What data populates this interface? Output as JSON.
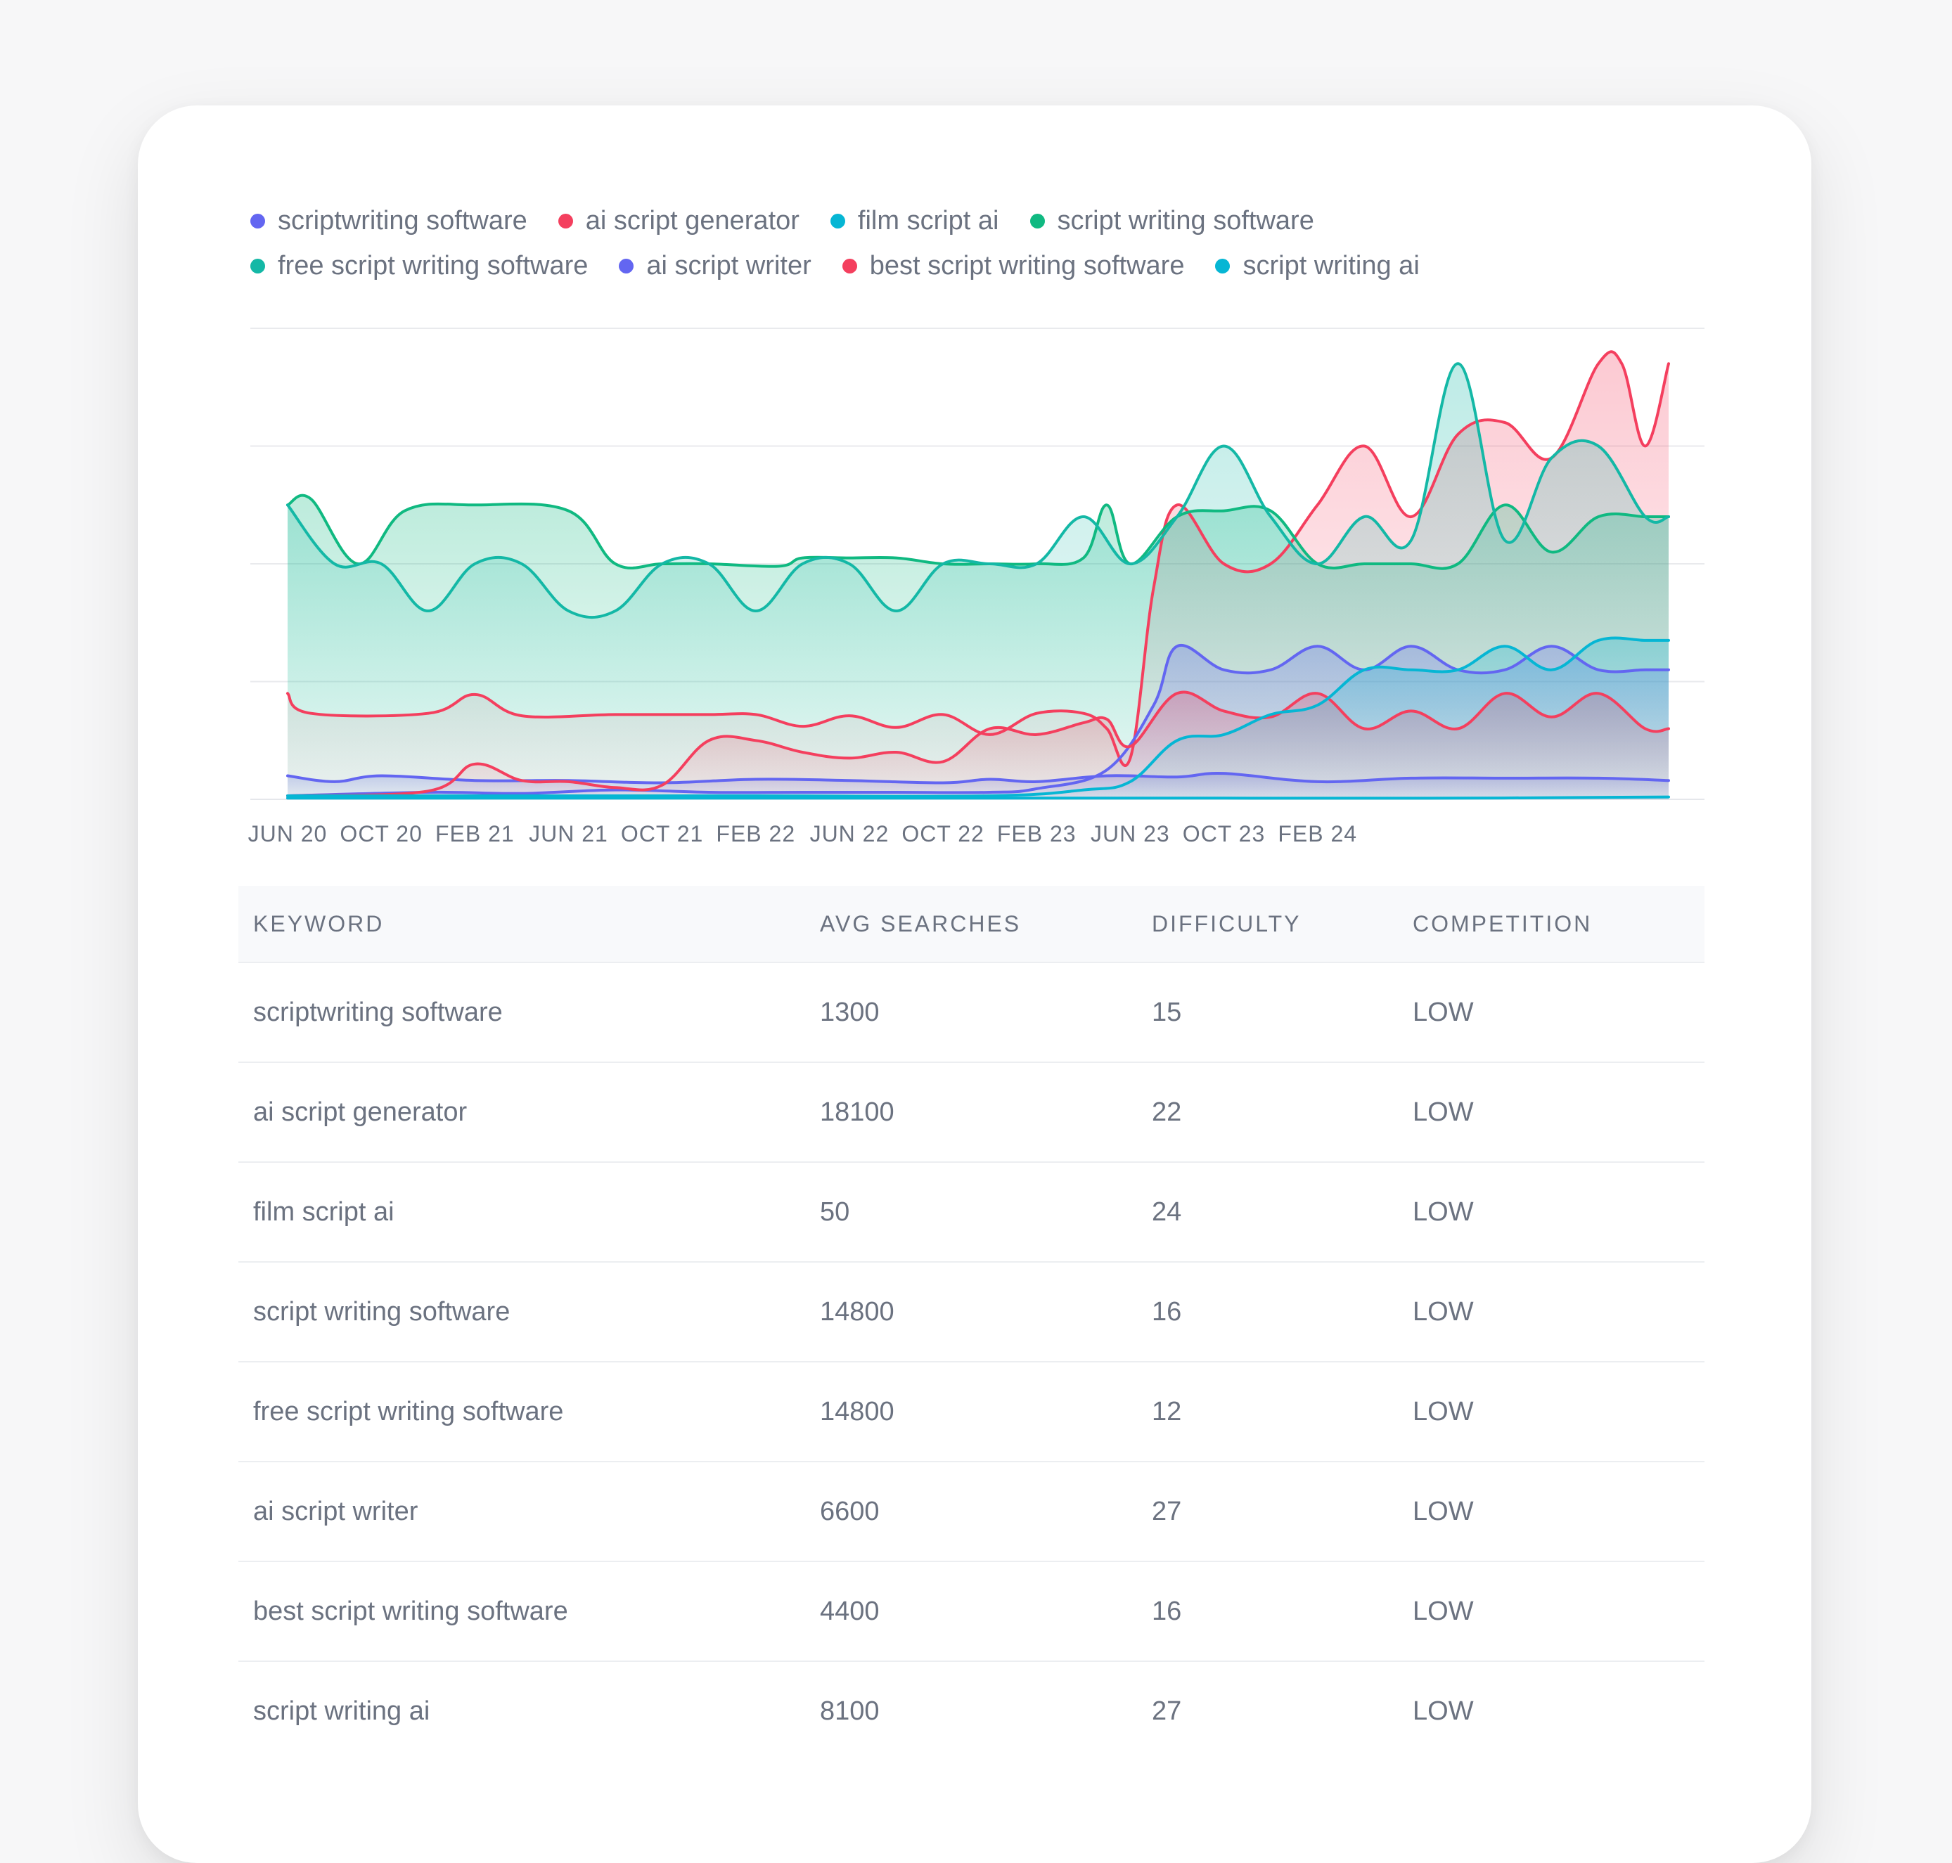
{
  "chart_data": {
    "type": "area",
    "x": [
      "JUN 20",
      "OCT 20",
      "FEB 21",
      "JUN 21",
      "OCT 21",
      "FEB 22",
      "JUN 22",
      "OCT 22",
      "FEB 23",
      "JUN 23",
      "OCT 23",
      "FEB 24"
    ],
    "x_tick_labels": [
      "JUN 20",
      "OCT 20",
      "FEB 21",
      "JUN 21",
      "OCT 21",
      "FEB 22",
      "JUN 22",
      "OCT 22",
      "FEB 23",
      "JUN 23",
      "OCT 23",
      "FEB 24"
    ],
    "ylim": [
      0,
      40
    ],
    "grid": true,
    "legend_position": "top-left",
    "series": [
      {
        "name": "scriptwriting software",
        "color": "#6366f1",
        "points": [
          [
            0,
            2
          ],
          [
            2,
            1.5
          ],
          [
            4,
            2
          ],
          [
            8,
            1.6
          ],
          [
            12,
            1.6
          ],
          [
            16,
            1.4
          ],
          [
            20,
            1.7
          ],
          [
            24,
            1.6
          ],
          [
            28,
            1.4
          ],
          [
            30,
            1.7
          ],
          [
            32,
            1.5
          ],
          [
            35,
            2
          ],
          [
            38,
            1.9
          ],
          [
            40,
            2.2
          ],
          [
            44,
            1.5
          ],
          [
            48,
            1.8
          ],
          [
            52,
            1.8
          ],
          [
            56,
            1.8
          ],
          [
            59,
            1.6
          ]
        ]
      },
      {
        "name": "ai script generator",
        "color": "#f43f5e",
        "points": [
          [
            0,
            9
          ],
          [
            1,
            7.3
          ],
          [
            6,
            7.3
          ],
          [
            8,
            8.9
          ],
          [
            10,
            7.1
          ],
          [
            14,
            7.2
          ],
          [
            18,
            7.2
          ],
          [
            20,
            7.2
          ],
          [
            22,
            6.2
          ],
          [
            24,
            7.1
          ],
          [
            26,
            6.1
          ],
          [
            28,
            7.2
          ],
          [
            30,
            5.5
          ],
          [
            32,
            7.3
          ],
          [
            34,
            7.3
          ],
          [
            35,
            6
          ],
          [
            36,
            3.5
          ],
          [
            37,
            18
          ],
          [
            38,
            25
          ],
          [
            40,
            20
          ],
          [
            42,
            20
          ],
          [
            44,
            25
          ],
          [
            46,
            30
          ],
          [
            48,
            24
          ],
          [
            50,
            31
          ],
          [
            52,
            32
          ],
          [
            54,
            29
          ],
          [
            56,
            37
          ],
          [
            57,
            37
          ],
          [
            58,
            30
          ],
          [
            59,
            37
          ]
        ]
      },
      {
        "name": "film script ai",
        "color": "#06b6d4",
        "points": [
          [
            0,
            0.1
          ],
          [
            10,
            0.1
          ],
          [
            20,
            0.1
          ],
          [
            30,
            0.1
          ],
          [
            40,
            0.1
          ],
          [
            50,
            0.1
          ],
          [
            59,
            0.2
          ]
        ]
      },
      {
        "name": "script writing software",
        "color": "#10b981",
        "points": [
          [
            0,
            25
          ],
          [
            1,
            25.5
          ],
          [
            3,
            20
          ],
          [
            5,
            24.5
          ],
          [
            8,
            25
          ],
          [
            12,
            24.5
          ],
          [
            14,
            20
          ],
          [
            16,
            20
          ],
          [
            18,
            20
          ],
          [
            21,
            19.8
          ],
          [
            22,
            20.5
          ],
          [
            24,
            20.5
          ],
          [
            26,
            20.5
          ],
          [
            28,
            20
          ],
          [
            30,
            20
          ],
          [
            32,
            20
          ],
          [
            34,
            20.5
          ],
          [
            35,
            25
          ],
          [
            36,
            20
          ],
          [
            38,
            24
          ],
          [
            40,
            24.5
          ],
          [
            42,
            24.5
          ],
          [
            44,
            20
          ],
          [
            46,
            20
          ],
          [
            48,
            20
          ],
          [
            50,
            20
          ],
          [
            52,
            25
          ],
          [
            54,
            21
          ],
          [
            56,
            24
          ],
          [
            58,
            24
          ],
          [
            59,
            24
          ]
        ]
      },
      {
        "name": "free script writing software",
        "color": "#14b8a6",
        "points": [
          [
            0,
            25
          ],
          [
            2,
            20
          ],
          [
            4,
            20
          ],
          [
            6,
            16
          ],
          [
            8,
            20
          ],
          [
            10,
            20
          ],
          [
            12,
            16
          ],
          [
            14,
            16
          ],
          [
            16,
            20
          ],
          [
            18,
            20
          ],
          [
            20,
            16
          ],
          [
            22,
            20
          ],
          [
            24,
            20
          ],
          [
            26,
            16
          ],
          [
            28,
            20
          ],
          [
            30,
            20
          ],
          [
            32,
            20
          ],
          [
            34,
            24
          ],
          [
            36,
            20
          ],
          [
            38,
            24
          ],
          [
            40,
            30
          ],
          [
            42,
            24
          ],
          [
            44,
            20
          ],
          [
            46,
            24
          ],
          [
            48,
            22
          ],
          [
            50,
            37
          ],
          [
            52,
            22
          ],
          [
            54,
            29
          ],
          [
            56,
            30
          ],
          [
            58,
            24
          ],
          [
            59,
            24
          ]
        ]
      },
      {
        "name": "ai script writer",
        "color": "#6366f1",
        "points": [
          [
            0,
            0.3
          ],
          [
            6,
            0.6
          ],
          [
            10,
            0.5
          ],
          [
            14,
            0.8
          ],
          [
            18,
            0.6
          ],
          [
            22,
            0.6
          ],
          [
            26,
            0.6
          ],
          [
            30,
            0.6
          ],
          [
            32,
            0.9
          ],
          [
            35,
            2.5
          ],
          [
            37,
            8
          ],
          [
            38,
            13
          ],
          [
            40,
            11
          ],
          [
            42,
            11
          ],
          [
            44,
            13
          ],
          [
            46,
            11
          ],
          [
            48,
            13
          ],
          [
            50,
            11
          ],
          [
            52,
            11
          ],
          [
            54,
            13
          ],
          [
            56,
            11
          ],
          [
            58,
            11
          ],
          [
            59,
            11
          ]
        ]
      },
      {
        "name": "best script writing software",
        "color": "#f43f5e",
        "points": [
          [
            0,
            0.3
          ],
          [
            6,
            0.7
          ],
          [
            8,
            3
          ],
          [
            10,
            1.6
          ],
          [
            12,
            1.5
          ],
          [
            14,
            1
          ],
          [
            16,
            1.2
          ],
          [
            18,
            5
          ],
          [
            20,
            5
          ],
          [
            22,
            4
          ],
          [
            24,
            3.5
          ],
          [
            26,
            4
          ],
          [
            28,
            3.2
          ],
          [
            30,
            6
          ],
          [
            32,
            5.5
          ],
          [
            34,
            6.5
          ],
          [
            35,
            6.8
          ],
          [
            36,
            4.5
          ],
          [
            38,
            9
          ],
          [
            40,
            7.5
          ],
          [
            42,
            7
          ],
          [
            44,
            9
          ],
          [
            46,
            6
          ],
          [
            48,
            7.5
          ],
          [
            50,
            6
          ],
          [
            52,
            9
          ],
          [
            54,
            7
          ],
          [
            56,
            9
          ],
          [
            58,
            6
          ],
          [
            59,
            6
          ]
        ]
      },
      {
        "name": "script writing ai",
        "color": "#06b6d4",
        "points": [
          [
            0,
            0.3
          ],
          [
            10,
            0.3
          ],
          [
            20,
            0.3
          ],
          [
            30,
            0.3
          ],
          [
            34,
            0.8
          ],
          [
            36,
            1.5
          ],
          [
            38,
            5
          ],
          [
            40,
            5.5
          ],
          [
            42,
            7.2
          ],
          [
            44,
            8
          ],
          [
            46,
            11
          ],
          [
            48,
            11
          ],
          [
            50,
            11
          ],
          [
            52,
            13
          ],
          [
            54,
            11
          ],
          [
            56,
            13.5
          ],
          [
            58,
            13.5
          ],
          [
            59,
            13.5
          ]
        ]
      }
    ]
  },
  "table": {
    "headers": {
      "keyword": "KEYWORD",
      "avg": "AVG SEARCHES",
      "difficulty": "DIFFICULTY",
      "competition": "COMPETITION"
    },
    "rows": [
      {
        "keyword": "scriptwriting software",
        "avg": "1300",
        "difficulty": "15",
        "competition": "LOW"
      },
      {
        "keyword": "ai script generator",
        "avg": "18100",
        "difficulty": "22",
        "competition": "LOW"
      },
      {
        "keyword": "film script ai",
        "avg": "50",
        "difficulty": "24",
        "competition": "LOW"
      },
      {
        "keyword": "script writing software",
        "avg": "14800",
        "difficulty": "16",
        "competition": "LOW"
      },
      {
        "keyword": "free script writing software",
        "avg": "14800",
        "difficulty": "12",
        "competition": "LOW"
      },
      {
        "keyword": "ai script writer",
        "avg": "6600",
        "difficulty": "27",
        "competition": "LOW"
      },
      {
        "keyword": "best script writing software",
        "avg": "4400",
        "difficulty": "16",
        "competition": "LOW"
      },
      {
        "keyword": "script writing ai",
        "avg": "8100",
        "difficulty": "27",
        "competition": "LOW"
      }
    ]
  }
}
